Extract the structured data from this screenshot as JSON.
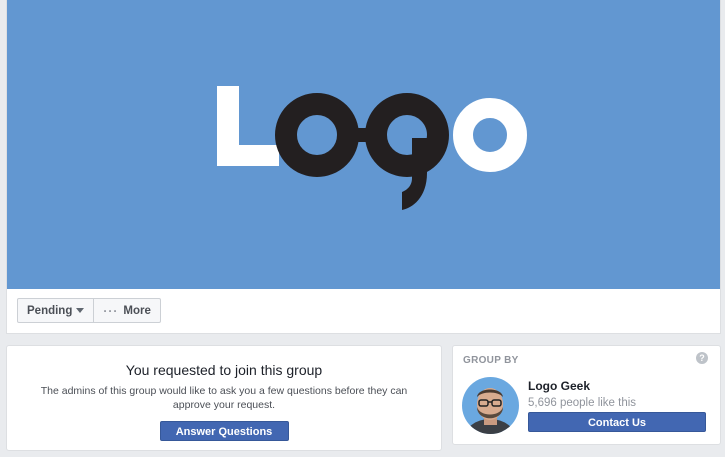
{
  "cover": {
    "logo_text": "Logo",
    "colors": {
      "background": "#6297d1",
      "logo_light": "#ffffff",
      "logo_dark": "#231f20"
    }
  },
  "actions": {
    "pending_label": "Pending",
    "more_label": "More"
  },
  "join": {
    "title": "You requested to join this group",
    "subtitle": "The admins of this group would like to ask you a few questions before they can approve your request.",
    "button_label": "Answer Questions"
  },
  "group_by": {
    "heading": "GROUP BY",
    "help_glyph": "?",
    "page_name": "Logo Geek",
    "likes": "5,696 people like this",
    "contact_label": "Contact Us"
  },
  "colors": {
    "accent": "#4267b2",
    "page_bg": "#e9ebee"
  }
}
